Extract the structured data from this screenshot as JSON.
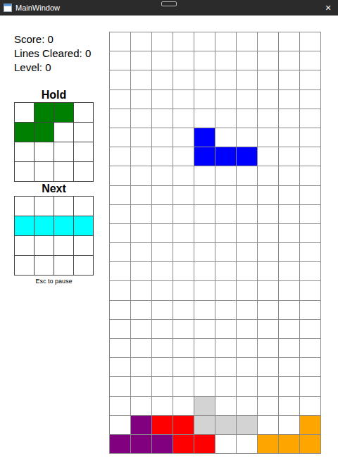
{
  "window": {
    "title": "MainWindow",
    "close": "×"
  },
  "stats": [
    "Score: 0",
    "Lines Cleared: 0",
    "Level: 0"
  ],
  "hold": {
    "title": "Hold",
    "cells": [
      [
        null,
        "#008000",
        "#008000",
        null
      ],
      [
        "#008000",
        "#008000",
        null,
        null
      ],
      [
        null,
        null,
        null,
        null
      ],
      [
        null,
        null,
        null,
        null
      ]
    ]
  },
  "next": {
    "title": "Next",
    "cells": [
      [
        null,
        null,
        null,
        null
      ],
      [
        "#00ffff",
        "#00ffff",
        "#00ffff",
        "#00ffff"
      ],
      [
        null,
        null,
        null,
        null
      ],
      [
        null,
        null,
        null,
        null
      ]
    ]
  },
  "hint": "Esc to pause",
  "board": {
    "rows": [
      [
        null,
        null,
        null,
        null,
        null,
        null,
        null,
        null,
        null,
        null
      ],
      [
        null,
        null,
        null,
        null,
        null,
        null,
        null,
        null,
        null,
        null
      ],
      [
        null,
        null,
        null,
        null,
        null,
        null,
        null,
        null,
        null,
        null
      ],
      [
        null,
        null,
        null,
        null,
        null,
        null,
        null,
        null,
        null,
        null
      ],
      [
        null,
        null,
        null,
        null,
        null,
        null,
        null,
        null,
        null,
        null
      ],
      [
        null,
        null,
        null,
        null,
        "#0000ff",
        null,
        null,
        null,
        null,
        null
      ],
      [
        null,
        null,
        null,
        null,
        "#0000ff",
        "#0000ff",
        "#0000ff",
        null,
        null,
        null
      ],
      [
        null,
        null,
        null,
        null,
        null,
        null,
        null,
        null,
        null,
        null
      ],
      [
        null,
        null,
        null,
        null,
        null,
        null,
        null,
        null,
        null,
        null
      ],
      [
        null,
        null,
        null,
        null,
        null,
        null,
        null,
        null,
        null,
        null
      ],
      [
        null,
        null,
        null,
        null,
        null,
        null,
        null,
        null,
        null,
        null
      ],
      [
        null,
        null,
        null,
        null,
        null,
        null,
        null,
        null,
        null,
        null
      ],
      [
        null,
        null,
        null,
        null,
        null,
        null,
        null,
        null,
        null,
        null
      ],
      [
        null,
        null,
        null,
        null,
        null,
        null,
        null,
        null,
        null,
        null
      ],
      [
        null,
        null,
        null,
        null,
        null,
        null,
        null,
        null,
        null,
        null
      ],
      [
        null,
        null,
        null,
        null,
        null,
        null,
        null,
        null,
        null,
        null
      ],
      [
        null,
        null,
        null,
        null,
        null,
        null,
        null,
        null,
        null,
        null
      ],
      [
        null,
        null,
        null,
        null,
        null,
        null,
        null,
        null,
        null,
        null
      ],
      [
        null,
        null,
        null,
        null,
        null,
        null,
        null,
        null,
        null,
        null
      ],
      [
        null,
        null,
        null,
        null,
        "#d3d3d3",
        null,
        null,
        null,
        null,
        null
      ],
      [
        null,
        "#800080",
        "#ff0000",
        "#ff0000",
        "#d3d3d3",
        "#d3d3d3",
        "#d3d3d3",
        null,
        null,
        "#ffa500"
      ],
      [
        "#800080",
        "#800080",
        "#800080",
        "#ff0000",
        "#ff0000",
        null,
        null,
        "#ffa500",
        "#ffa500",
        "#ffa500"
      ]
    ]
  }
}
